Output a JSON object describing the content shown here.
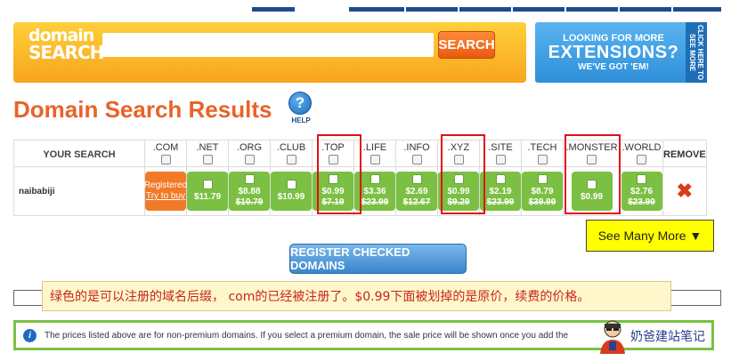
{
  "search": {
    "logo_line1": "domain",
    "logo_line2": "SEARCH",
    "input_value": "",
    "button_label": "SEARCH"
  },
  "ad": {
    "line1": "LOOKING FOR MORE",
    "line2": "EXTENSIONS?",
    "line3": "WE'VE GOT 'EM!",
    "side": "CLICK HERE TO SEE MORE"
  },
  "page_title": "Domain Search Results",
  "help_label": "HELP",
  "table": {
    "your_search_header": "YOUR SEARCH",
    "remove_header": "REMOVE",
    "extensions": [
      ".COM",
      ".NET",
      ".ORG",
      ".CLUB",
      ".TOP",
      ".LIFE",
      ".INFO",
      ".XYZ",
      ".SITE",
      ".TECH",
      ".MONSTER",
      ".WORLD"
    ],
    "row": {
      "domain": "naibabiji",
      "com_status_line1": "Registered",
      "com_status_line2": "Try to buy",
      "prices": [
        {
          "price": "$11.79",
          "original": ""
        },
        {
          "price": "$8.88",
          "original": "$10.79"
        },
        {
          "price": "$10.99",
          "original": ""
        },
        {
          "price": "$0.99",
          "original": "$7.19"
        },
        {
          "price": "$3.36",
          "original": "$23.99"
        },
        {
          "price": "$2.69",
          "original": "$12.67"
        },
        {
          "price": "$0.99",
          "original": "$9.29"
        },
        {
          "price": "$2.19",
          "original": "$23.99"
        },
        {
          "price": "$8.79",
          "original": "$39.99"
        },
        {
          "price": "$0.99",
          "original": ""
        },
        {
          "price": "$2.76",
          "original": "$23.99"
        }
      ],
      "remove_icon": "x-icon"
    }
  },
  "see_more": "See Many More ▼",
  "register_button": "REGISTER CHECKED DOMAINS",
  "annotation": "绿色的是可以注册的域名后缀， com的已经被注册了。$0.99下面被划掉的是原价，续费的价格。",
  "notice": "The prices listed above are for non-premium domains. If you select a premium domain, the sale price will be shown once you add the",
  "watermark": "奶爸建站笔记",
  "colors": {
    "accent_orange": "#e8632a",
    "available_green": "#7bc043",
    "registered_orange": "#f07a28",
    "highlight_red": "#e0101a"
  }
}
